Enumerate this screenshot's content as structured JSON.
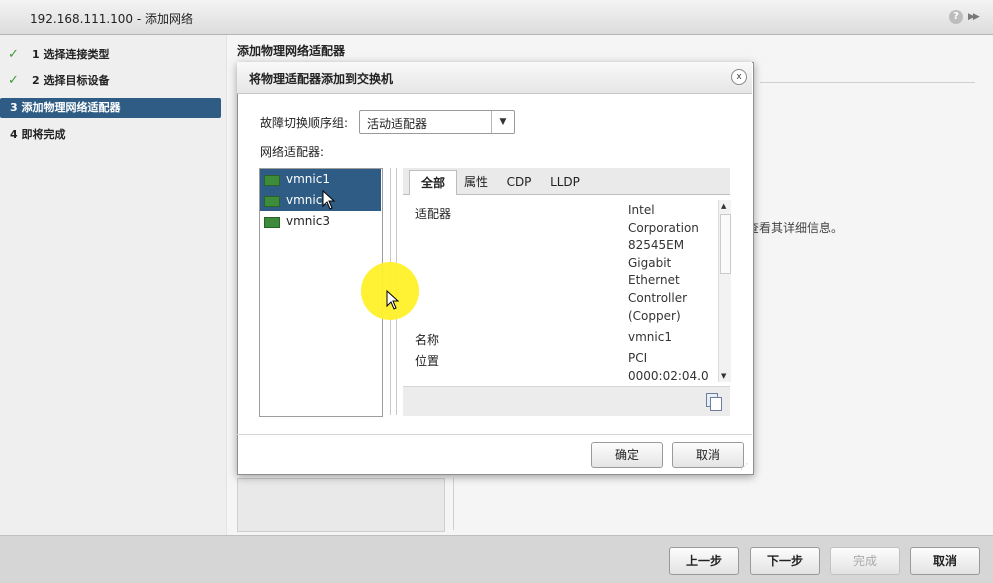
{
  "window": {
    "title": "192.168.111.100 - 添加网络",
    "help_label": "?",
    "expand_label": "▶▶"
  },
  "steps": [
    {
      "label": "1  选择连接类型",
      "done": true
    },
    {
      "label": "2  选择目标设备",
      "done": true
    },
    {
      "label": "3  添加物理网络适配器",
      "active": true
    },
    {
      "label": "4  即将完成"
    }
  ],
  "content": {
    "section_title": "添加物理网络适配器",
    "hint": "查看其详细信息。"
  },
  "dialog": {
    "title": "将物理适配器添加到交换机",
    "close_label": "x",
    "failover_label": "故障切换顺序组:",
    "failover_value": "活动适配器",
    "adapters_label": "网络适配器:",
    "adapters": [
      {
        "name": "vmnic1",
        "selected": true
      },
      {
        "name": "vmnic2",
        "selected": true
      },
      {
        "name": "vmnic3",
        "selected": false
      }
    ],
    "tabs": [
      "全部",
      "属性",
      "CDP",
      "LLDP"
    ],
    "active_tab": "全部",
    "properties": [
      {
        "key": "适配器",
        "value_lines": [
          "Intel",
          "Corporation",
          "82545EM",
          "Gigabit",
          "Ethernet",
          "Controller",
          "(Copper)"
        ]
      },
      {
        "key": "名称",
        "value_lines": [
          "vmnic1"
        ]
      },
      {
        "key": "位置",
        "value_lines": [
          "PCI",
          "0000:02:04.0"
        ]
      }
    ],
    "ok_label": "确定",
    "cancel_label": "取消"
  },
  "footer": {
    "back_label": "上一步",
    "next_label": "下一步",
    "finish_label": "完成",
    "cancel_label": "取消"
  },
  "colors": {
    "selection": "#2e5c85",
    "check": "#3d9a39",
    "cursor_highlight": "#fff028"
  }
}
